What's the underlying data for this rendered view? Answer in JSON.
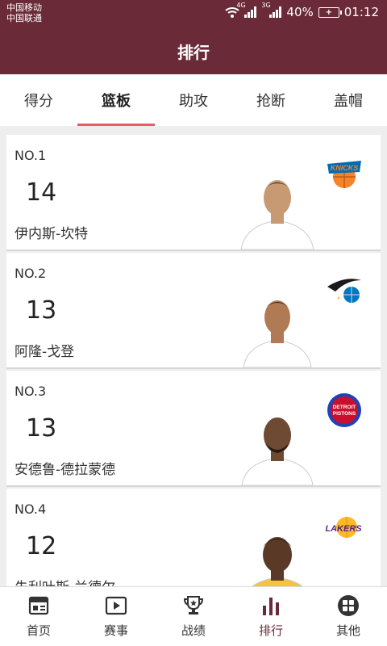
{
  "status": {
    "carrier1": "中国移动",
    "carrier2": "中国联通",
    "net1": "4G",
    "net2": "3G",
    "battery": "40%",
    "time": "01:12"
  },
  "header": {
    "title": "排行"
  },
  "tabs": [
    {
      "label": "得分"
    },
    {
      "label": "篮板"
    },
    {
      "label": "助攻"
    },
    {
      "label": "抢断"
    },
    {
      "label": "盖帽"
    }
  ],
  "active_tab": "篮板",
  "ranking": [
    {
      "rank": "NO.1",
      "value": "14",
      "name": "伊内斯-坎特",
      "team_logo": "knicks-logo-icon",
      "jersey": "#ffffff",
      "skin": "#c79a74"
    },
    {
      "rank": "NO.2",
      "value": "13",
      "name": "阿隆-戈登",
      "team_logo": "magic-logo-icon",
      "jersey": "#ffffff",
      "skin": "#b07a55"
    },
    {
      "rank": "NO.3",
      "value": "13",
      "name": "安德鲁-德拉蒙德",
      "team_logo": "pistons-logo-icon",
      "jersey": "#ffffff",
      "skin": "#6e4a32"
    },
    {
      "rank": "NO.4",
      "value": "12",
      "name": "朱利叶斯-兰德尔",
      "team_logo": "lakers-logo-icon",
      "jersey": "#f5c242",
      "skin": "#5a3a26"
    }
  ],
  "bottom_nav": [
    {
      "label": "首页",
      "icon": "home-icon"
    },
    {
      "label": "赛事",
      "icon": "play-icon"
    },
    {
      "label": "战绩",
      "icon": "trophy-icon"
    },
    {
      "label": "排行",
      "icon": "ranking-icon"
    },
    {
      "label": "其他",
      "icon": "grid-icon"
    }
  ],
  "colors": {
    "brand": "#6b2a37",
    "tab_indicator": "#e85a6a",
    "knicks_orange": "#f58426",
    "knicks_blue": "#006bb6",
    "magic_blue": "#0077c0",
    "pistons_red": "#c8102e",
    "pistons_blue": "#1d42ba",
    "lakers_purple": "#552583",
    "lakers_gold": "#fdb927"
  }
}
